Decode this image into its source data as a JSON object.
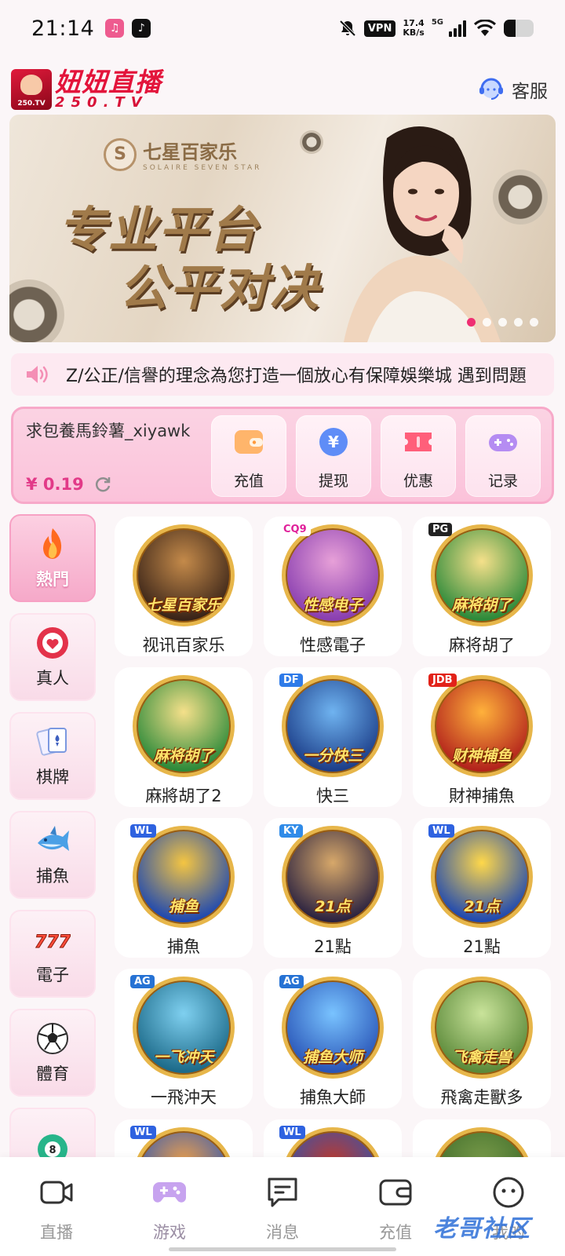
{
  "status_bar": {
    "time": "21:14",
    "vpn": "VPN",
    "speed_value": "17.4",
    "speed_unit": "KB/s",
    "network": "5G",
    "battery_level": 0.4
  },
  "header": {
    "logo_cn": "妞妞直播",
    "logo_en": "250.TV",
    "logo_badge": "250.TV",
    "service_label": "客服"
  },
  "banner": {
    "brand_cn": "七星百家乐",
    "brand_en": "SOLAIRE SEVEN STAR",
    "line1": "专业平台",
    "line2": "公平对决",
    "slide_count": 5,
    "active_slide": 0
  },
  "notice": {
    "text": "Z/公正/信譽的理念為您打造一個放心有保障娛樂城  遇到問題"
  },
  "wallet": {
    "username": "求包養馬鈴薯_xiyawk",
    "balance": "¥ 0.19",
    "actions": [
      {
        "label": "充值",
        "icon": "wallet-icon"
      },
      {
        "label": "提现",
        "icon": "yen-coin-icon"
      },
      {
        "label": "优惠",
        "icon": "ticket-icon"
      },
      {
        "label": "记录",
        "icon": "gamepad-icon"
      }
    ]
  },
  "categories": [
    {
      "label": "熱門",
      "icon": "flame-icon",
      "active": true
    },
    {
      "label": "真人",
      "icon": "poker-chip-icon"
    },
    {
      "label": "棋牌",
      "icon": "playing-cards-icon"
    },
    {
      "label": "捕魚",
      "icon": "shark-icon"
    },
    {
      "label": "電子",
      "icon": "slot-777-icon"
    },
    {
      "label": "體育",
      "icon": "soccer-ball-icon"
    },
    {
      "label": "",
      "icon": "lottery-ball-icon"
    }
  ],
  "games": [
    {
      "name": "视讯百家乐",
      "caption": "七星百家乐",
      "tag": ""
    },
    {
      "name": "性感電子",
      "caption": "性感电子",
      "tag": "CQ9"
    },
    {
      "name": "麻将胡了",
      "caption": "麻将胡了",
      "tag": "PG"
    },
    {
      "name": "麻將胡了2",
      "caption": "麻将胡了",
      "tag": ""
    },
    {
      "name": "快三",
      "caption": "一分快三",
      "tag": "DF"
    },
    {
      "name": "財神捕魚",
      "caption": "财神捕鱼",
      "tag": "JDB"
    },
    {
      "name": "捕魚",
      "caption": "捕鱼",
      "tag": "WL"
    },
    {
      "name": "21點",
      "caption": "21点",
      "tag": "KY"
    },
    {
      "name": "21點",
      "caption": "21点",
      "tag": "WL"
    },
    {
      "name": "一飛沖天",
      "caption": "一飞冲天",
      "tag": "AG"
    },
    {
      "name": "捕魚大師",
      "caption": "捕鱼大师",
      "tag": "AG"
    },
    {
      "name": "飛禽走獸多",
      "caption": "飞禽走兽",
      "tag": ""
    },
    {
      "name": "",
      "caption": "",
      "tag": "WL"
    },
    {
      "name": "",
      "caption": "",
      "tag": "WL"
    },
    {
      "name": "",
      "caption": "",
      "tag": ""
    }
  ],
  "tabs": [
    {
      "label": "直播",
      "icon": "camera-icon"
    },
    {
      "label": "游戏",
      "icon": "gamepad-icon",
      "active": true
    },
    {
      "label": "消息",
      "icon": "message-icon"
    },
    {
      "label": "充值",
      "icon": "wallet-icon"
    },
    {
      "label": "我的",
      "icon": "face-icon"
    }
  ],
  "watermark": "老哥社区",
  "colors": {
    "accent_pink": "#ef2e72",
    "brand_red": "#e3143b",
    "balance_pink": "#e23a88"
  }
}
